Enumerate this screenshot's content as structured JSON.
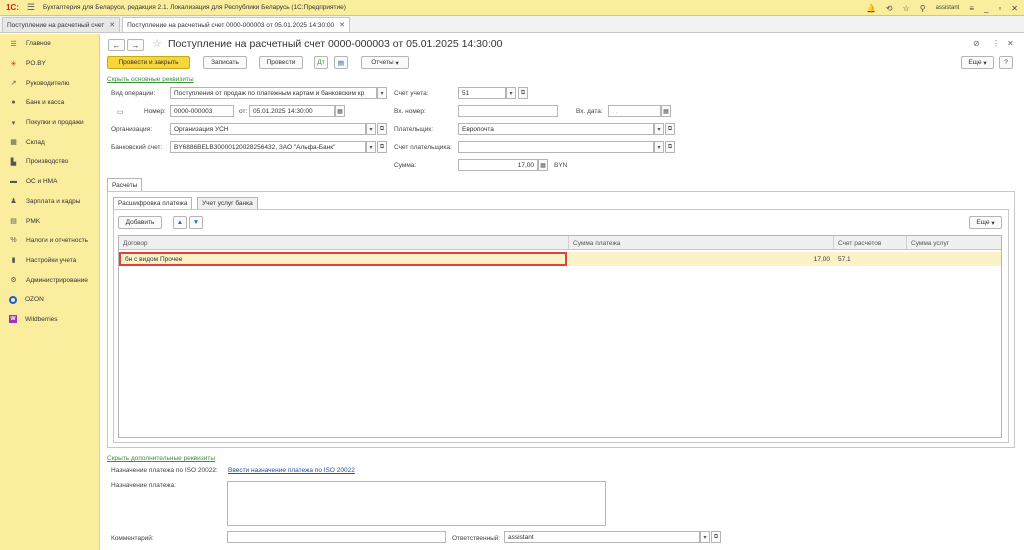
{
  "app": {
    "logo": "1С:",
    "title": "Бухгалтерия для Беларуси, редакция 2.1. Локализация для Республики Беларусь   (1С:Предприятие)",
    "user": "assistant"
  },
  "tabs": [
    {
      "label": "Поступление на расчетный счет"
    },
    {
      "label": "Поступление на расчетный счет 0000-000003 от 05.01.2025 14:30:00"
    }
  ],
  "sidebar": {
    "items": [
      {
        "label": "Главное",
        "icon": "menu-icon"
      },
      {
        "label": "PO.BY",
        "icon": "asterisk-icon"
      },
      {
        "label": "Руководителю",
        "icon": "trend-icon"
      },
      {
        "label": "Банк и касса",
        "icon": "coin-icon"
      },
      {
        "label": "Покупки и продажи",
        "icon": "cart-icon"
      },
      {
        "label": "Склад",
        "icon": "warehouse-icon"
      },
      {
        "label": "Производство",
        "icon": "factory-icon"
      },
      {
        "label": "ОС и НМА",
        "icon": "truck-icon"
      },
      {
        "label": "Зарплата и кадры",
        "icon": "person-icon"
      },
      {
        "label": "PMK",
        "icon": "register-icon"
      },
      {
        "label": "Налоги и отчетность",
        "icon": "percent-icon"
      },
      {
        "label": "Настройки учета",
        "icon": "book-icon"
      },
      {
        "label": "Администрирование",
        "icon": "gear-icon"
      },
      {
        "label": "OZON",
        "icon": "ozon-icon"
      },
      {
        "label": "Wildberries",
        "icon": "wildberries-icon"
      }
    ]
  },
  "doc": {
    "title": "Поступление на расчетный счет 0000-000003 от 05.01.2025 14:30:00"
  },
  "toolbar": {
    "post_close": "Провести и закрыть",
    "save": "Записать",
    "post": "Провести",
    "reports": "Отчеты",
    "more": "Еще"
  },
  "form": {
    "hide_main": "Скрыть основные реквизиты",
    "op_type_label": "Вид операции:",
    "op_type_value": "Поступления от продаж по платежным картам и банковским кр",
    "number_label": "Номер:",
    "number_value": "0000-000003",
    "date_from_label": "от:",
    "date_value": "05.01.2025 14:30:00",
    "org_label": "Организация:",
    "org_value": "Организация УСН",
    "bank_acc_label": "Банковский счет:",
    "bank_acc_value": "BY6886BELB30000120028256432, ЗАО \"Альфа-Банк\"",
    "account_label": "Счет учета:",
    "account_value": "51",
    "in_number_label": "Вх. номер:",
    "in_number_value": "",
    "in_date_label": "Вх. дата:",
    "in_date_value": " .  .",
    "payer_label": "Плательщик:",
    "payer_value": "Европочта",
    "payer_acc_label": "Счет плательщика:",
    "payer_acc_value": "",
    "sum_label": "Сумма:",
    "sum_value": "17,00",
    "currency": "BYN"
  },
  "section": {
    "tab": "Расчеты",
    "subtab_active": "Расшифровка платежа",
    "subtab_other": "Учет услуг банка",
    "add_button": "Добавить",
    "more": "Еще"
  },
  "table": {
    "columns": [
      "Договор",
      "Сумма платежа",
      "Счет расчетов",
      "Сумма услуг"
    ],
    "rows": [
      {
        "contract": "бн с видом Прочее",
        "amount": "17,00",
        "account": "57.1",
        "services": ""
      }
    ]
  },
  "footer": {
    "hide_extra": "Скрыть дополнительные реквизиты",
    "iso_label": "Назначение платежа по ISO 20022:",
    "iso_link": "Ввести назначение платежа по ISO 20022",
    "purpose_label": "Назначение платежа:",
    "purpose_value": "",
    "comment_label": "Комментарий:",
    "comment_value": "",
    "responsible_label": "Ответственный:",
    "responsible_value": "assistant"
  }
}
